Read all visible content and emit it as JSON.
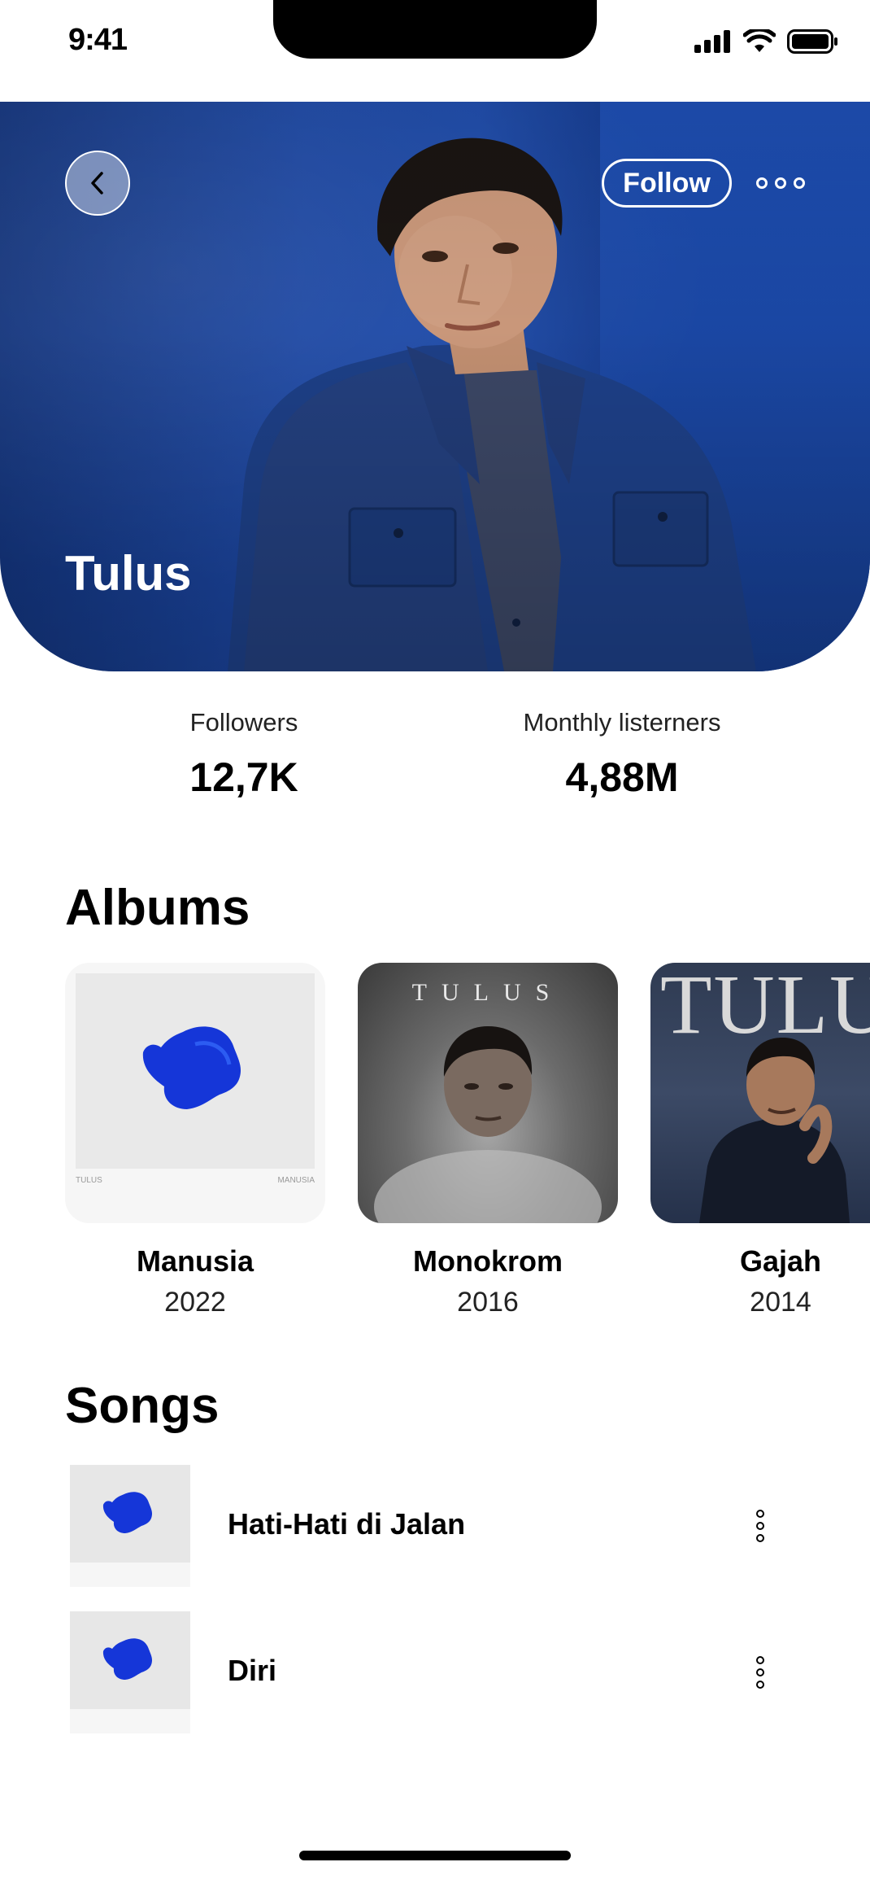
{
  "status_bar": {
    "time": "9:41"
  },
  "artist": {
    "name": "Tulus",
    "follow_label": "Follow"
  },
  "stats": {
    "followers_label": "Followers",
    "followers_value": "12,7K",
    "listeners_label": "Monthly listerners",
    "listeners_value": "4,88M"
  },
  "albums": {
    "title": "Albums",
    "items": [
      {
        "title": "Manusia",
        "year": "2022",
        "cover_foot_left": "TULUS",
        "cover_foot_right": "MANUSIA"
      },
      {
        "title": "Monokrom",
        "year": "2016",
        "cover_word": "TULUS"
      },
      {
        "title": "Gajah",
        "year": "2014",
        "cover_word": "TULUS"
      }
    ]
  },
  "songs": {
    "title": "Songs",
    "items": [
      {
        "title": "Hati-Hati di Jalan"
      },
      {
        "title": "Diri"
      }
    ]
  },
  "colors": {
    "hero_blue": "#1c47a3",
    "sculpture_blue": "#1536d8"
  }
}
